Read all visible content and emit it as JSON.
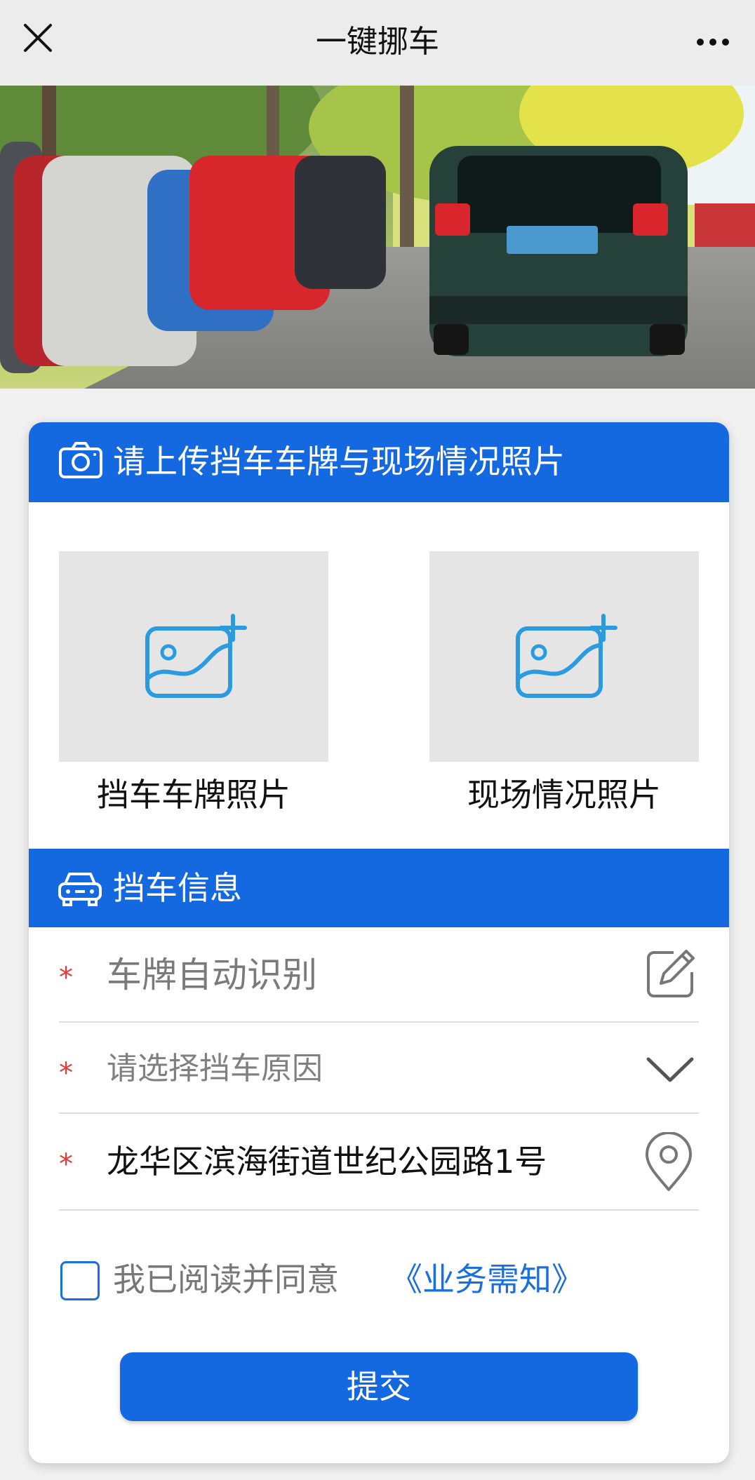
{
  "nav": {
    "title": "一键挪车",
    "close_icon": "close-icon",
    "more_icon": "more-icon"
  },
  "upload": {
    "heading": "请上传挡车车牌与现场情况照片",
    "heading_icon": "camera-icon",
    "slots": [
      {
        "caption": "挡车车牌照片",
        "icon": "add-image-icon"
      },
      {
        "caption": "现场情况照片",
        "icon": "add-image-icon"
      }
    ]
  },
  "info": {
    "heading": "挡车信息",
    "heading_icon": "car-icon",
    "required_mark": "*",
    "plate_placeholder": "车牌自动识别",
    "reason_placeholder": "请选择挡车原因",
    "location_value": "龙华区滨海街道世纪公园路1号"
  },
  "agreement": {
    "text": "我已阅读并同意",
    "link": "《业务需知》"
  },
  "submit_label": "提交",
  "colors": {
    "primary": "#1468e0",
    "required": "#e53935",
    "link": "#1a6fe0",
    "icon_blue": "#2a9be0"
  }
}
